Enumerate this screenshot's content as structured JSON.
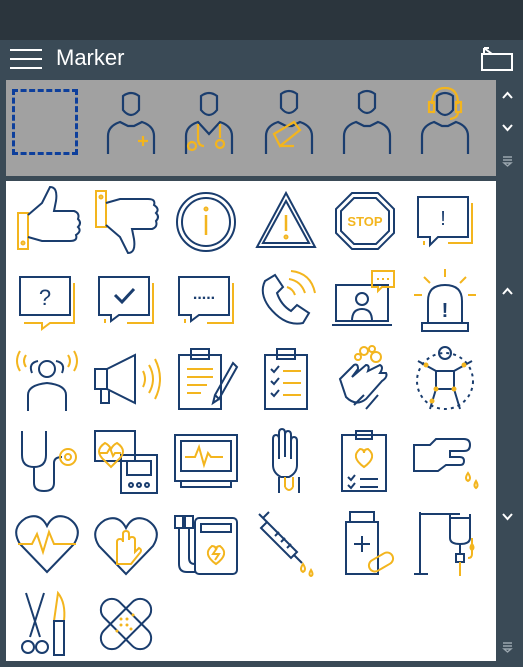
{
  "window": {
    "title": "Marker"
  },
  "header": {
    "menu_icon": "hamburger-menu-icon",
    "collapse_icon": "collapse-panel-icon"
  },
  "colors": {
    "topbar": "#2b353d",
    "panel": "#3a4a56",
    "strip": "#a1a1a1",
    "icon_blue": "#1a3d6e",
    "icon_yellow": "#f3b51e",
    "selection": "#0d3f9c"
  },
  "profile_strip": {
    "items": [
      {
        "icon": "selection-box-icon"
      },
      {
        "icon": "patient-plus-icon"
      },
      {
        "icon": "doctor-stethoscope-icon"
      },
      {
        "icon": "patient-arm-sling-icon"
      },
      {
        "icon": "person-icon"
      },
      {
        "icon": "headset-operator-icon"
      }
    ],
    "scroll": [
      "scroll-up-icon",
      "scroll-down-icon",
      "dropdown-icon"
    ]
  },
  "marker_grid": {
    "items": [
      {
        "icon": "thumbs-up-icon"
      },
      {
        "icon": "thumbs-down-icon"
      },
      {
        "icon": "info-icon"
      },
      {
        "icon": "warning-icon"
      },
      {
        "icon": "stop-sign-icon",
        "text": "STOP"
      },
      {
        "icon": "exclamation-bubble-icon",
        "text": "!"
      },
      {
        "icon": "question-bubble-icon",
        "text": "?"
      },
      {
        "icon": "checkmark-bubble-icon"
      },
      {
        "icon": "ellipsis-bubble-icon",
        "text": "....."
      },
      {
        "icon": "phone-call-icon"
      },
      {
        "icon": "video-call-icon"
      },
      {
        "icon": "alarm-light-icon",
        "text": "!"
      },
      {
        "icon": "stress-person-icon"
      },
      {
        "icon": "megaphone-icon"
      },
      {
        "icon": "clipboard-pencil-icon"
      },
      {
        "icon": "checklist-icon"
      },
      {
        "icon": "hand-washing-icon"
      },
      {
        "icon": "body-joints-icon"
      },
      {
        "icon": "stethoscope-icon"
      },
      {
        "icon": "vital-monitor-devices-icon"
      },
      {
        "icon": "ecg-monitor-icon"
      },
      {
        "icon": "gloved-hand-icon"
      },
      {
        "icon": "medical-report-icon"
      },
      {
        "icon": "blood-drop-finger-icon"
      },
      {
        "icon": "heart-pulse-icon"
      },
      {
        "icon": "heart-hand-icon"
      },
      {
        "icon": "defibrillator-icon"
      },
      {
        "icon": "syringe-icon"
      },
      {
        "icon": "medicine-bottle-icon"
      },
      {
        "icon": "iv-drip-icon"
      },
      {
        "icon": "surgical-tools-icon"
      },
      {
        "icon": "bandage-icon"
      }
    ],
    "scroll": [
      "scroll-up-icon",
      "scroll-down-icon",
      "dropdown-icon"
    ]
  }
}
